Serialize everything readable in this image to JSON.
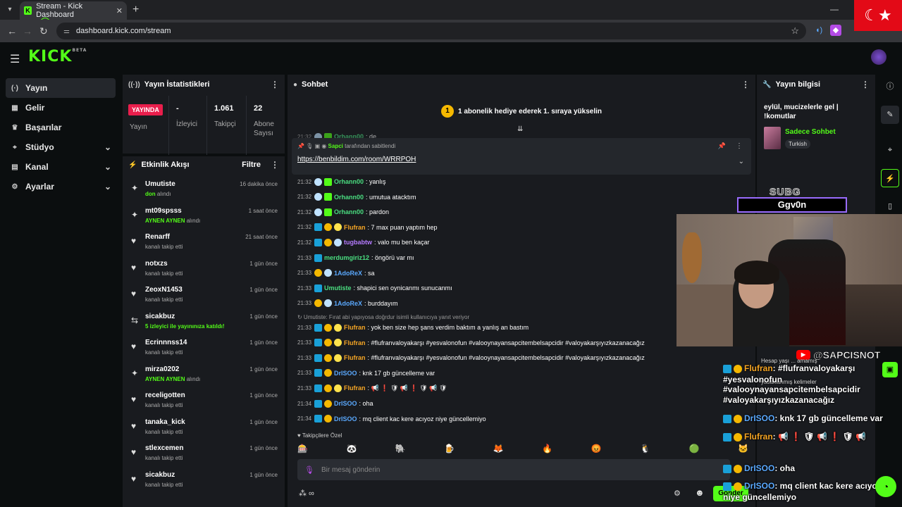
{
  "browser": {
    "tab_title": "Stream - Kick Dashboard",
    "tab_icon": "K",
    "url": "dashboard.kick.com/stream"
  },
  "header": {
    "logo": "KICK",
    "logo_sup": "BETA"
  },
  "nav": [
    {
      "label": "Yayın",
      "icon": "(·)",
      "active": true,
      "chev": false
    },
    {
      "label": "Gelir",
      "icon": "▦",
      "chev": false
    },
    {
      "label": "Başarılar",
      "icon": "🏆",
      "chev": false
    },
    {
      "label": "Stüdyo",
      "icon": "⌖",
      "chev": true
    },
    {
      "label": "Kanal",
      "icon": "▤",
      "chev": true
    },
    {
      "label": "Ayarlar",
      "icon": "⚙",
      "chev": true
    }
  ],
  "stats": {
    "title": "Yayın İstatistikleri",
    "live_badge": "YAYINDA",
    "live_label": "Yayın",
    "viewers_value": "-",
    "viewers_label": "İzleyici",
    "followers_value": "1.061",
    "followers_label": "Takipçi",
    "subs_value": "22",
    "subs_label_1": "Abone",
    "subs_label_2": "Sayısı"
  },
  "activity": {
    "title": "Etkinlik Akışı",
    "filter": "Filtre",
    "items": [
      {
        "name": "Umutiste",
        "sub_hl": "don",
        "sub": " alındı",
        "time": "16 dakika önce",
        "icon": "✦"
      },
      {
        "name": "mt09spsss",
        "sub_hl": "AYNEN AYNEN",
        "sub": " alındı",
        "time": "1 saat önce",
        "icon": "✦"
      },
      {
        "name": "Renarff",
        "sub_hl": "",
        "sub": "kanalı takip etti",
        "time": "21 saat önce",
        "icon": "♥"
      },
      {
        "name": "notxzs",
        "sub_hl": "",
        "sub": "kanalı takip etti",
        "time": "1 gün önce",
        "icon": "♥"
      },
      {
        "name": "ZeoxN1453",
        "sub_hl": "",
        "sub": "kanalı takip etti",
        "time": "1 gün önce",
        "icon": "♥"
      },
      {
        "name": "sicakbuz",
        "sub_hl": "5 izleyici ile yayınınıza katıldı!",
        "sub": "",
        "time": "1 gün önce",
        "icon": "⇆"
      },
      {
        "name": "Ecrinnnss14",
        "sub_hl": "",
        "sub": "kanalı takip etti",
        "time": "1 gün önce",
        "icon": "♥"
      },
      {
        "name": "mirza0202",
        "sub_hl": "AYNEN AYNEN",
        "sub": " alındı",
        "time": "1 gün önce",
        "icon": "✦"
      },
      {
        "name": "receligotten",
        "sub_hl": "",
        "sub": "kanalı takip etti",
        "time": "1 gün önce",
        "icon": "♥"
      },
      {
        "name": "tanaka_kick",
        "sub_hl": "",
        "sub": "kanalı takip etti",
        "time": "1 gün önce",
        "icon": "♥"
      },
      {
        "name": "stlexcemen",
        "sub_hl": "",
        "sub": "kanalı takip etti",
        "time": "1 gün önce",
        "icon": "♥"
      },
      {
        "name": "sicakbuz",
        "sub_hl": "",
        "sub": "kanalı takip etti",
        "time": "1 gün önce",
        "icon": "♥"
      }
    ]
  },
  "chat": {
    "title": "Sohbet",
    "gift_banner": "1 abonelik hediye ederek 1. sıraya yükselin",
    "gift_coin": "1",
    "pinned_user": "Sapci",
    "pinned_by_text": " tarafından sabitlendi",
    "pinned_link": "https://benbildim.com/room/WRRPOH",
    "partial_time": "21:32",
    "partial_user": "Orhann00",
    "partial_text": ": de",
    "messages": [
      {
        "time": "21:32",
        "badges": [
          "ghost",
          "grn"
        ],
        "user": "Orhann00",
        "color": "#4ade80",
        "text": ": yanlış"
      },
      {
        "time": "21:32",
        "badges": [
          "ghost",
          "grn"
        ],
        "user": "Orhann00",
        "color": "#4ade80",
        "text": ": umutua atacktım"
      },
      {
        "time": "21:32",
        "badges": [
          "ghost",
          "grn"
        ],
        "user": "Orhann00",
        "color": "#4ade80",
        "text": ": pardon"
      },
      {
        "time": "21:32",
        "badges": [
          "sub",
          "coin",
          "yel"
        ],
        "user": "Flufran",
        "color": "#f5a524",
        "text": ": 7 max puan yaptım hep"
      },
      {
        "time": "21:32",
        "badges": [
          "sub",
          "coin",
          "ghost"
        ],
        "user": "tugbabtw",
        "color": "#b57bff",
        "text": ": valo mu ben kaçar"
      },
      {
        "time": "21:33",
        "badges": [
          "sub"
        ],
        "user": "merdumgiriz12",
        "color": "#4ade80",
        "text": ": öngörü var mı"
      },
      {
        "time": "21:33",
        "badges": [
          "coin",
          "ghost"
        ],
        "user": "1AdoReX",
        "color": "#5aa9ff",
        "text": ": sa"
      },
      {
        "time": "21:33",
        "badges": [
          "sub"
        ],
        "user": "Umutiste",
        "color": "#4ade80",
        "text": ": shapici sen oynicanmı sunucanmı"
      },
      {
        "time": "21:33",
        "badges": [
          "coin",
          "ghost"
        ],
        "user": "1AdoReX",
        "color": "#5aa9ff",
        "text": ": burddayım"
      }
    ],
    "reply_note": "↻ Umutiste: Fırat abi yapıyosa doğrdur isimli kullanıcıya yanıt veriyor",
    "messages2": [
      {
        "time": "21:33",
        "badges": [
          "sub",
          "coin",
          "yel"
        ],
        "user": "Flufran",
        "color": "#f5a524",
        "text": ": yok ben size hep şans verdim baktım a yanlış an bastım"
      },
      {
        "time": "21:33",
        "badges": [
          "sub",
          "coin",
          "yel"
        ],
        "user": "Flufran",
        "color": "#f5a524",
        "text": ": #flufranvaloyakarşı #yesvalonofun #valooynayansapcitembelsapcidir #valoyakarşıyızkazanacağız"
      },
      {
        "time": "21:33",
        "badges": [
          "sub",
          "coin",
          "yel"
        ],
        "user": "Flufran",
        "color": "#f5a524",
        "text": ": #flufranvaloyakarşı #yesvalonofun #valooynayansapcitembelsapcidir #valoyakarşıyızkazanacağız"
      },
      {
        "time": "21:33",
        "badges": [
          "sub",
          "coin"
        ],
        "user": "DrISOO",
        "color": "#5aa9ff",
        "text": ": knk 17 gb güncelleme var"
      },
      {
        "time": "21:33",
        "badges": [
          "sub",
          "coin",
          "yel"
        ],
        "user": "Flufran",
        "color": "#f5a524",
        "text": ": 📢 ❗ 🛡 📢 ❗ 🛡 📢 🛡"
      },
      {
        "time": "21:34",
        "badges": [
          "sub",
          "coin"
        ],
        "user": "DrISOO",
        "color": "#5aa9ff",
        "text": ": oha"
      },
      {
        "time": "21:34",
        "badges": [
          "sub",
          "coin"
        ],
        "user": "DrISOO",
        "color": "#5aa9ff",
        "text": ": mq client kac kere acıyoz niye güncellemiyo"
      }
    ],
    "follow_note": "♥ Takipçilere Özel",
    "emotes": [
      "🎰",
      "🐼",
      "🐘",
      "🍺",
      "🦊",
      "🔥",
      "😡",
      "🐧",
      "🟢",
      "🐱"
    ],
    "input_placeholder": "Bir mesaj gönderin",
    "foot_left": "⁂ ∞",
    "send_label": "Gönder"
  },
  "stream_info": {
    "title": "Yayın bilgisi",
    "stream_title": "eylül, mucizelerle gel | !komutlar",
    "category": "Sadece Sohbet",
    "language": "Turkish"
  },
  "overlay": {
    "subg_label": "SUBG",
    "subg_name": "Ggv0n",
    "yt_handle": "@SAPCISNOT",
    "small_1": "Hesap yaşı ... amamış",
    "small_2": "yasaklanmış kelimeler",
    "lines": [
      {
        "user": "Flufran",
        "color": "#f5a524",
        "text": ": #flufranvaloyakarşı"
      },
      {
        "user": "",
        "color": "#fff",
        "text": "#yesvalonofun"
      },
      {
        "user": "",
        "color": "#fff",
        "text": "#valooynayansapcitembelsapcidir"
      },
      {
        "user": "",
        "color": "#fff",
        "text": "#valoyakarşıyızkazanacağız"
      },
      {
        "user": "DrISOO",
        "color": "#5aa9ff",
        "text": ": knk 17 gb güncelleme var"
      },
      {
        "user": "Flufran",
        "color": "#f5a524",
        "text": ": 📢 ❗ 🛡 📢 ❗ 🛡 📢"
      },
      {
        "user": "DrISOO",
        "color": "#5aa9ff",
        "text": ": oha"
      },
      {
        "user": "DrISOO",
        "color": "#5aa9ff",
        "text": ": mq client kac kere acıyoz"
      },
      {
        "user": "",
        "color": "#fff",
        "text": "niye güncellemiyo"
      }
    ]
  }
}
